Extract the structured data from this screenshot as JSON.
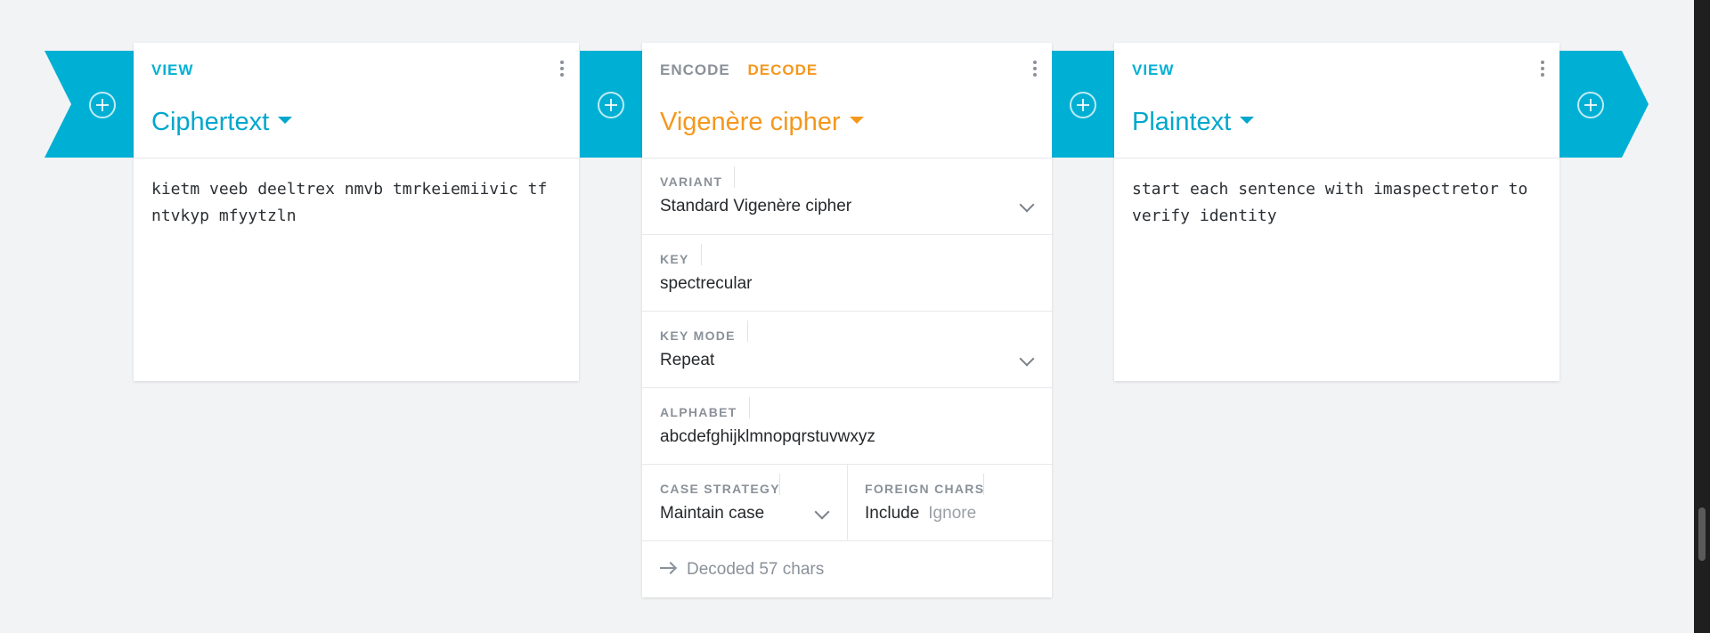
{
  "colors": {
    "accent": "#00b0d4",
    "decode": "#f4981d",
    "muted": "#8a9199",
    "background": "#f2f3f5"
  },
  "icons": {
    "add": "plus-circle-icon",
    "menu": "kebab-menu-icon",
    "dropdown": "chevron-down-icon",
    "arrow": "arrow-right-icon"
  },
  "ciphertext_view": {
    "mode_label": "VIEW",
    "title": "Ciphertext",
    "content": "kietm veeb deeltrex nmvb tmrkeiemiivic tf ntvkyp mfyytzln"
  },
  "cipher": {
    "encode_label": "ENCODE",
    "decode_label": "DECODE",
    "active_mode": "DECODE",
    "title": "Vigenère cipher",
    "settings": {
      "variant": {
        "label": "VARIANT",
        "value": "Standard Vigenère cipher"
      },
      "key": {
        "label": "KEY",
        "value": "spectrecular"
      },
      "key_mode": {
        "label": "KEY MODE",
        "value": "Repeat"
      },
      "alphabet": {
        "label": "ALPHABET",
        "value": "abcdefghijklmnopqrstuvwxyz"
      },
      "case_strategy": {
        "label": "CASE STRATEGY",
        "value": "Maintain case"
      },
      "foreign_chars": {
        "label": "FOREIGN CHARS",
        "options": [
          "Include",
          "Ignore"
        ],
        "selected": "Include"
      }
    },
    "status": "Decoded 57 chars"
  },
  "plaintext_view": {
    "mode_label": "VIEW",
    "title": "Plaintext",
    "content": "start each sentence with imaspectretor to verify identity"
  }
}
